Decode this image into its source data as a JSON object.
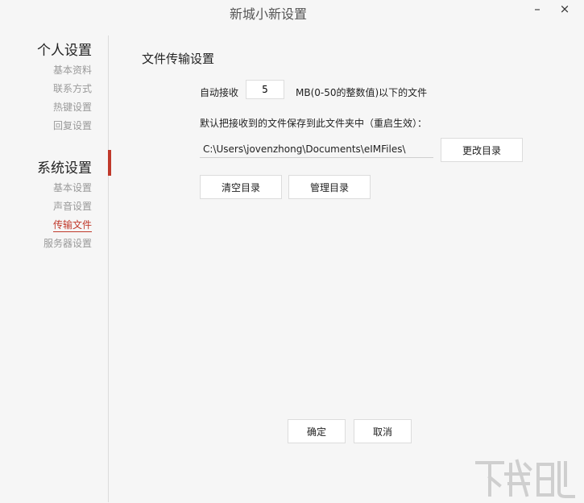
{
  "window": {
    "title": "新城小新设置",
    "minimize_label": "–",
    "close_label": "×"
  },
  "sidebar": {
    "groups": [
      {
        "title": "个人设置",
        "items": [
          "基本资料",
          "联系方式",
          "热键设置",
          "回复设置"
        ]
      },
      {
        "title": "系统设置",
        "items": [
          "基本设置",
          "声音设置",
          "传输文件",
          "服务器设置"
        ]
      }
    ],
    "active_item": "传输文件",
    "accent_color": "#c0392b"
  },
  "content": {
    "section_title": "文件传输设置",
    "auto_receive_label": "自动接收",
    "auto_receive_value": "5",
    "auto_receive_suffix": "MB(0-50的整数值)以下的文件",
    "save_path_label": "默认把接收到的文件保存到此文件夹中（重启生效）：",
    "save_path_value": "C:\\Users\\jovenzhong\\Documents\\eIMFiles\\",
    "change_dir_button": "更改目录",
    "clear_dir_button": "清空目录",
    "manage_dir_button": "管理目录"
  },
  "footer": {
    "ok_button": "确定",
    "cancel_button": "取消"
  },
  "watermark": {
    "text": "下载吧"
  }
}
